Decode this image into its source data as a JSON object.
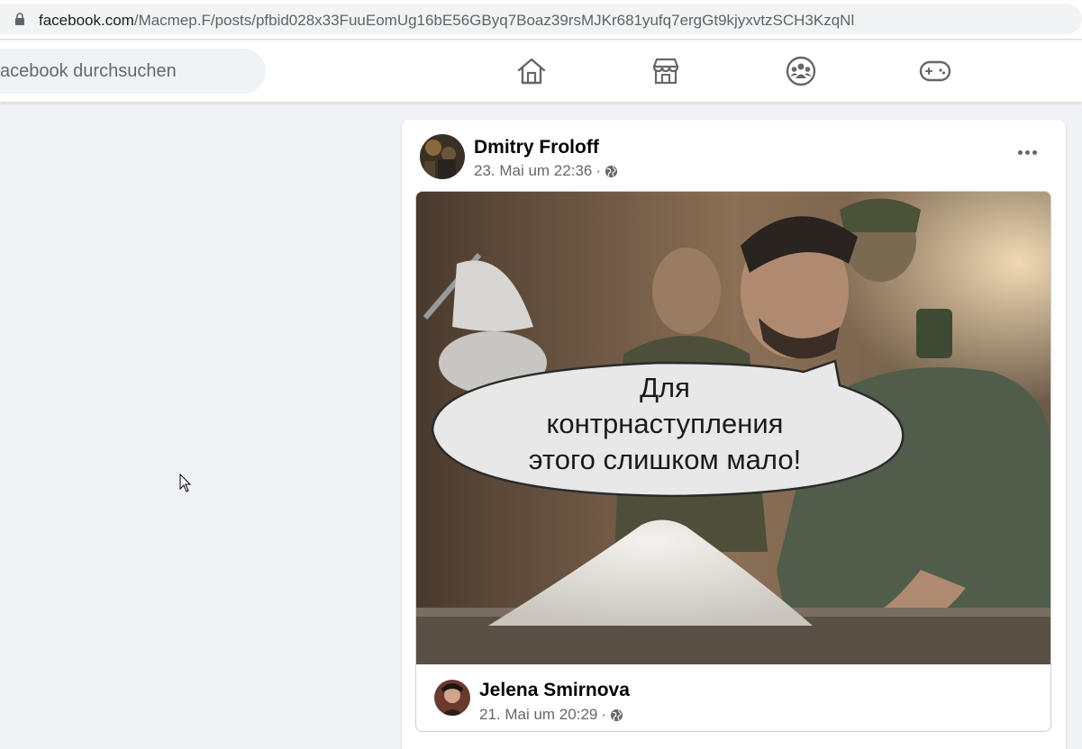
{
  "browser": {
    "url_domain": "facebook.com",
    "url_path": "/Macmep.F/posts/pfbid028x33FuuEomUg16bE56GByq7Boaz39rsMJKr681yufq7ergGt9kjyxvtzSCH3KzqNl"
  },
  "header": {
    "search_placeholder": "acebook durchsuchen",
    "nav": [
      "home-icon",
      "marketplace-icon",
      "groups-icon",
      "gaming-icon"
    ]
  },
  "post": {
    "author": "Dmitry Froloff",
    "timestamp": "23. Mai um 22:36",
    "separator": "·",
    "privacy_icon": "globe-icon",
    "shared": {
      "image_caption_lines": [
        "Для",
        "контрнаступления",
        "этого слишком мало!"
      ],
      "author": "Jelena Smirnova",
      "timestamp": "21. Mai um 20:29",
      "separator": "·"
    }
  },
  "colors": {
    "background": "#f0f2f5",
    "card": "#ffffff",
    "secondary_text": "#65676b",
    "icon": "#65676b"
  }
}
